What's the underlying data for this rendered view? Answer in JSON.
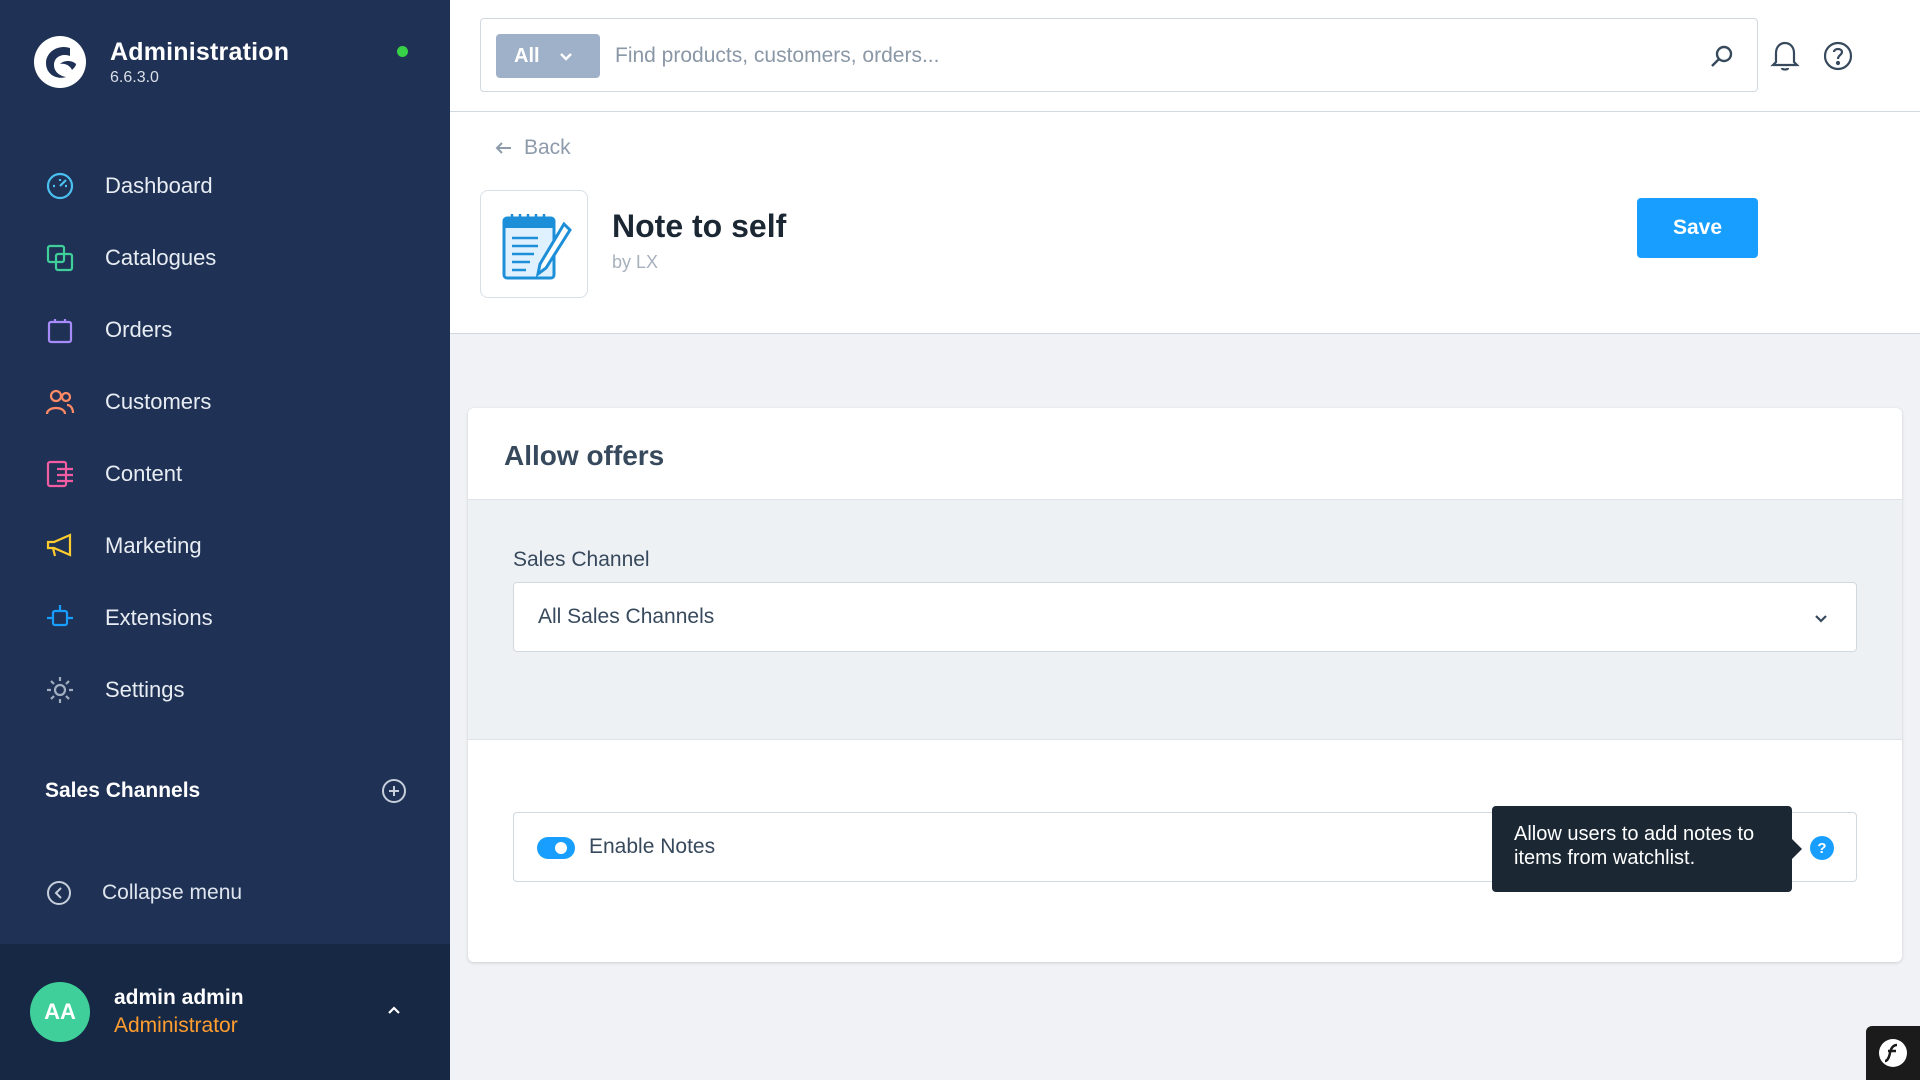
{
  "brand": {
    "title": "Administration",
    "version": "6.6.3.0",
    "status_color": "#37d046"
  },
  "sidebar": {
    "items": [
      {
        "label": "Dashboard",
        "icon": "dashboard-icon",
        "color": "#4ac1f0"
      },
      {
        "label": "Catalogues",
        "icon": "catalogues-icon",
        "color": "#3ecf9b"
      },
      {
        "label": "Orders",
        "icon": "orders-icon",
        "color": "#a78bfa"
      },
      {
        "label": "Customers",
        "icon": "customers-icon",
        "color": "#ff8a65"
      },
      {
        "label": "Content",
        "icon": "content-icon",
        "color": "#f25ca2"
      },
      {
        "label": "Marketing",
        "icon": "marketing-icon",
        "color": "#ffcc2e"
      },
      {
        "label": "Extensions",
        "icon": "extensions-icon",
        "color": "#189eff"
      },
      {
        "label": "Settings",
        "icon": "settings-icon",
        "color": "#a0aec0"
      }
    ],
    "sales_channels_title": "Sales Channels",
    "collapse_label": "Collapse menu"
  },
  "user": {
    "initials": "AA",
    "name": "admin admin",
    "role": "Administrator"
  },
  "search": {
    "type_label": "All",
    "placeholder": "Find products, customers, orders..."
  },
  "header": {
    "back_label": "Back",
    "title": "Note to self",
    "author": "by LX",
    "save_label": "Save"
  },
  "card": {
    "title": "Allow offers",
    "sales_channel_label": "Sales Channel",
    "sales_channel_value": "All Sales Channels",
    "enable_notes_label": "Enable Notes",
    "enable_notes_on": true,
    "help_badge": "?",
    "tooltip": "Allow users to add notes to items from watchlist."
  },
  "colors": {
    "sidebar_bg": "#1f3154",
    "accent": "#189eff",
    "role": "#ff9d2e",
    "avatar": "#3ecf9b"
  }
}
